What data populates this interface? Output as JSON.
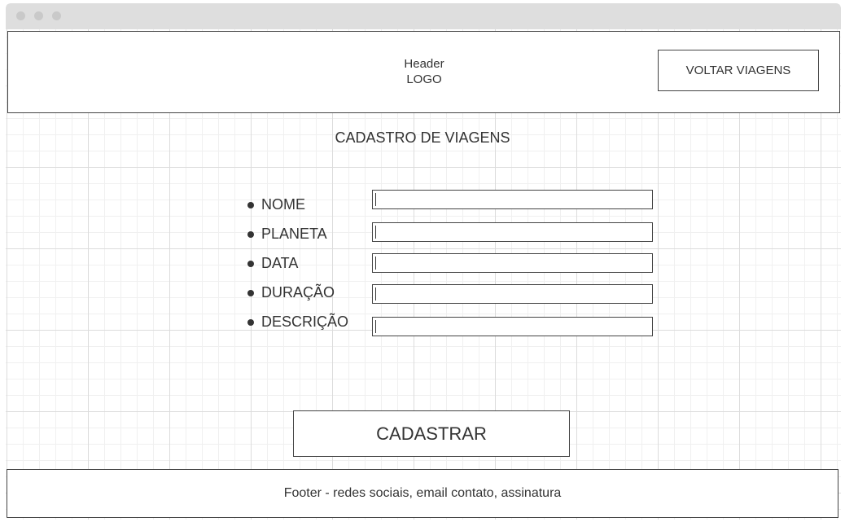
{
  "window": {
    "controls": [
      "close-dot",
      "minimize-dot",
      "maximize-dot"
    ]
  },
  "header": {
    "title": "Header",
    "logo": "LOGO",
    "back_button_label": "VOLTAR VIAGENS"
  },
  "main": {
    "title": "CADASTRO DE VIAGENS",
    "fields": [
      {
        "label": "NOME",
        "value": ""
      },
      {
        "label": "PLANETA",
        "value": ""
      },
      {
        "label": "DATA",
        "value": ""
      },
      {
        "label": "DURAÇÃO",
        "value": ""
      },
      {
        "label": "DESCRIÇÃO",
        "value": ""
      }
    ],
    "submit_label": "CADASTRAR"
  },
  "footer": {
    "text": "Footer - redes sociais, email contato, assinatura"
  }
}
